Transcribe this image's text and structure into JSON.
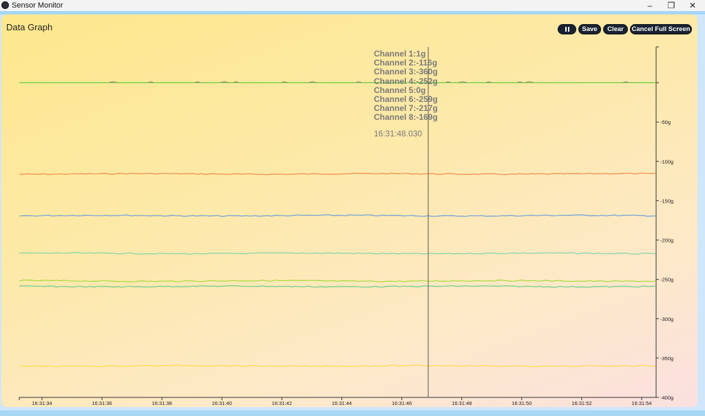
{
  "window": {
    "title": "Sensor Monitor",
    "controls": {
      "minimize": "–",
      "restore": "❐",
      "close": "✕"
    }
  },
  "panel": {
    "title": "Data Graph",
    "buttons": {
      "pause_icon": "pause-icon",
      "save": "Save",
      "clear": "Clear",
      "fullscreen": "Cancel Full Screen"
    }
  },
  "tooltip": {
    "lines": [
      "Channel 1:1g",
      "Channel 2:-116g",
      "Channel 3:-360g",
      "Channel 4:-252g",
      "Channel 5:0g",
      "Channel 6:-259g",
      "Channel 7:-217g",
      "Channel 8:-169g"
    ],
    "time": "16:31:48.030"
  },
  "colors": {
    "axis": "#333333",
    "cursor": "#555555",
    "tooltip_text": "#7a7a7a"
  },
  "chart_data": {
    "type": "line",
    "x_ticks": [
      "16:31:34",
      "16:31:36",
      "16:31:38",
      "16:31:40",
      "16:31:42",
      "16:31:44",
      "16:31:46",
      "16:31:48",
      "16:31:50",
      "16:31:52",
      "16:31:54"
    ],
    "y_ticks": [
      "-50g",
      "-100g",
      "-150g",
      "-200g",
      "-250g",
      "-300g",
      "-350g",
      "-400g"
    ],
    "ylim": [
      -400,
      0
    ],
    "cursor_time": "16:31:48.030",
    "series": [
      {
        "color": "#5cd03c",
        "base": 0
      },
      {
        "color": "#f08a4b",
        "base": -116
      },
      {
        "color": "#6aa0d8",
        "base": -169
      },
      {
        "color": "#7fd3a8",
        "base": -217
      },
      {
        "color": "#a6d93a",
        "base": -252
      },
      {
        "color": "#66cc88",
        "base": -259
      },
      {
        "color": "#ffd84a",
        "base": -360
      },
      {
        "color": "#9a8f6a",
        "base": 0,
        "bumps": true
      }
    ]
  }
}
